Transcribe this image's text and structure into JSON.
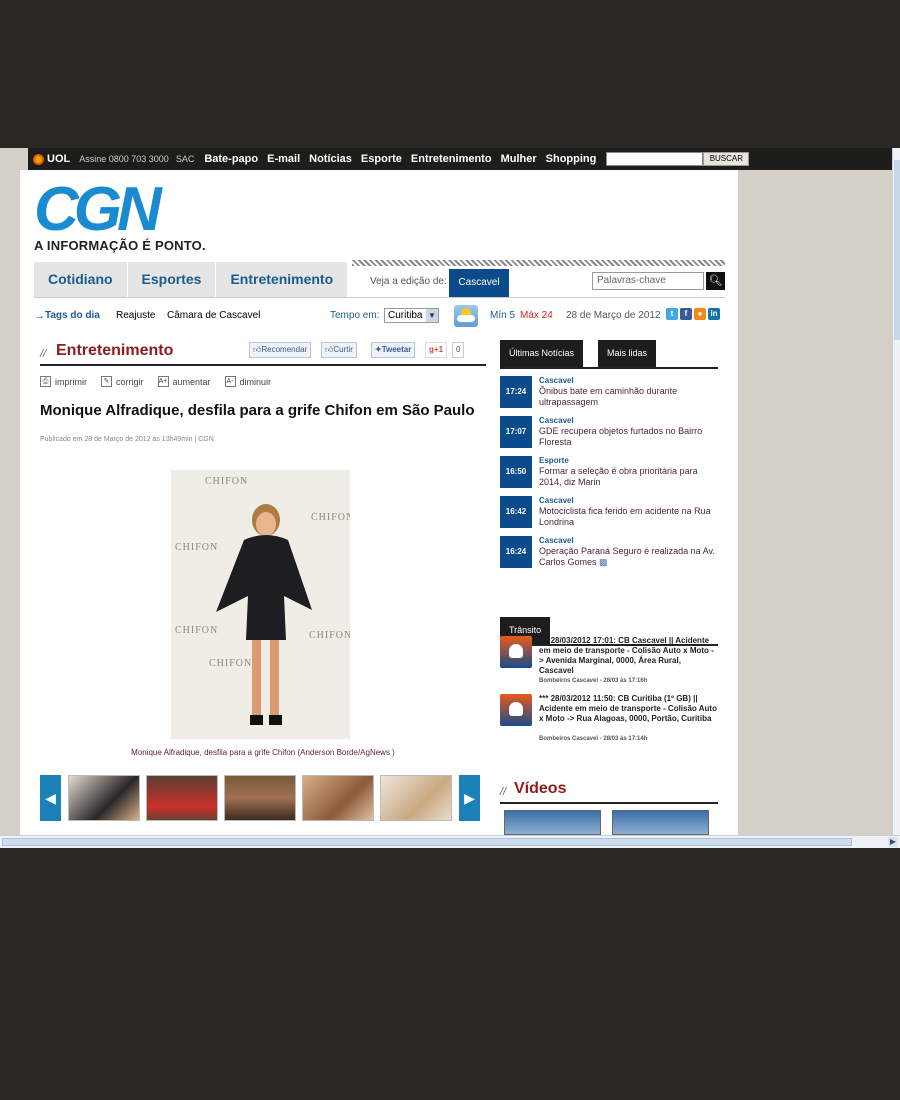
{
  "uol": {
    "logo": "UOL",
    "assine": "Assine 0800 703 3000",
    "sac": "SAC",
    "links": [
      "Bate-papo",
      "E-mail",
      "Notícias",
      "Esporte",
      "Entretenimento",
      "Mulher",
      "Shopping"
    ],
    "search_button": "BUSCAR"
  },
  "site": {
    "logo": "CGN",
    "tagline": "A INFORMAÇÃO É PONTO."
  },
  "nav": {
    "tabs": [
      "Cotidiano",
      "Esportes",
      "Entretenimento"
    ],
    "edition_label": "Veja a edição de:",
    "edition_value": "Cascavel",
    "keyword_placeholder": "Palavras-chave"
  },
  "tags": {
    "label": "Tags do dia",
    "items": [
      "Reajuste",
      "Câmara de Cascavel"
    ],
    "weather_label": "Tempo em:",
    "city": "Curitiba",
    "min": "Mín 5",
    "max": "Máx 24",
    "date": "28 de Março de 2012"
  },
  "article": {
    "section": "Entretenimento",
    "share": {
      "recomendar": "Recomendar",
      "curtir": "Curtir",
      "tweetar": "Tweetar",
      "gplus": "+1",
      "count": "0"
    },
    "tools": [
      "imprimir",
      "corrigir",
      "aumentar",
      "diminuir"
    ],
    "headline": "Monique Alfradique, desfila para a grife Chifon em São Paulo",
    "published": "Publicado em 28 de Março de 2012 às 13h49min | CGN",
    "photo_brand": "CHIFON",
    "caption": "Monique Alfradique, desfila para a grife Chifon (Anderson Borde/AgNews )"
  },
  "sidebar": {
    "tabs": [
      "Últimas Notícias",
      "Mais lidas"
    ],
    "news": [
      {
        "time": "17:24",
        "cat": "Cascavel",
        "text": "Ônibus bate em caminhão durante ultrapassagem"
      },
      {
        "time": "17:07",
        "cat": "Cascavel",
        "text": "GDE recupera objetos furtados no Bairro Floresta"
      },
      {
        "time": "16:50",
        "cat": "Esporte",
        "text": "Formar a seleção é obra prioritária para 2014, diz Marin"
      },
      {
        "time": "16:42",
        "cat": "Cascavel",
        "text": "Motociclista fica ferido em acidente na Rua Londrina"
      },
      {
        "time": "16:24",
        "cat": "Cascavel",
        "text": "Operação Paraná Seguro é realizada na Av. Carlos Gomes"
      }
    ],
    "transito_tab": "Trânsito",
    "transito": [
      {
        "text": "*** 28/03/2012 17:01: CB Cascavel || Acidente em meio de transporte - Colisão Auto x Moto -> Avenida Marginal, 0000, Área Rural, Cascavel",
        "src": "Bombeiros Cascavel - 28/03 às 17:16h"
      },
      {
        "text": "*** 28/03/2012 11:50: CB Curitiba (1º GB) || Acidente em meio de transporte - Colisão Auto x Moto -> Rua Alagoas, 0000, Portão, Curitiba",
        "src": "Bombeiros Cascavel - 28/03 às 17:14h"
      }
    ],
    "videos_title": "Vídeos"
  },
  "colors": {
    "brand_blue": "#1b8bd1",
    "nav_blue": "#0b4a8b",
    "section_red": "#8f1c1c"
  }
}
